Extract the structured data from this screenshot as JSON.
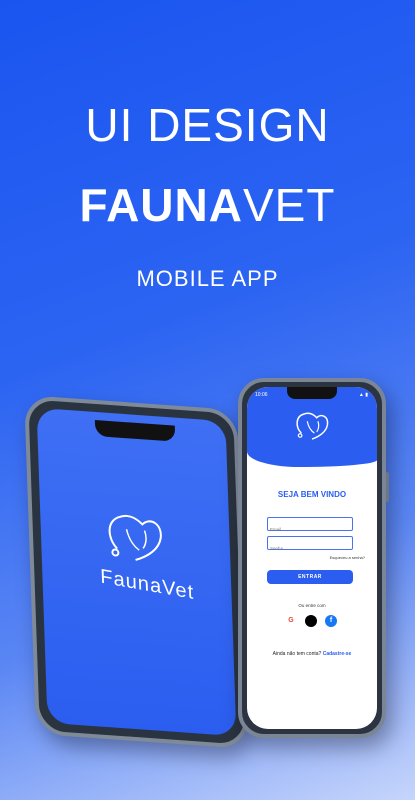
{
  "hero": {
    "line1": "UI DESIGN",
    "brand_bold": "FAUNA",
    "brand_light": "VET",
    "line3": "MOBILE APP"
  },
  "left_phone": {
    "logo_text": "FaunaVet"
  },
  "right_phone": {
    "time": "10:06",
    "status": "▲ ▮",
    "welcome": "SEJA BEM VINDO",
    "email_placeholder": "Email",
    "password_placeholder": "Senha",
    "forgot": "Esqueceu a senha?",
    "enter_button": "ENTRAR",
    "or_sign_in_with": "Ou entre com",
    "social": [
      {
        "name": "google",
        "glyph": "G",
        "color": "#ea4335"
      },
      {
        "name": "apple",
        "glyph": "",
        "color": "#000000"
      },
      {
        "name": "facebook",
        "glyph": "f",
        "color": "#1877f2"
      }
    ],
    "no_account": "Ainda não tem conta?",
    "signup_link": "Cadastre-se"
  }
}
